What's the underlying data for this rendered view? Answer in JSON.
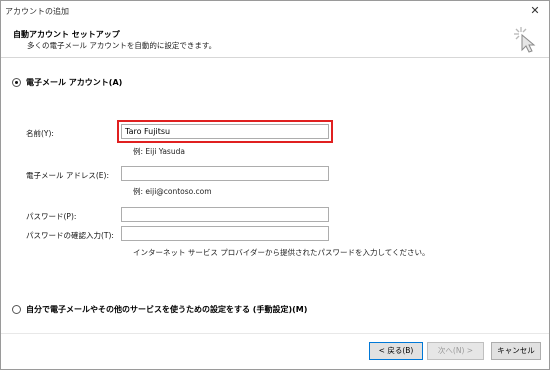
{
  "window": {
    "title": "アカウントの追加",
    "close_glyph": "✕"
  },
  "header": {
    "title": "自動アカウント セットアップ",
    "subtitle": "多くの電子メール アカウントを自動的に設定できます。",
    "icon": "wizard-cursor-icon"
  },
  "email_account": {
    "radio_label": "電子メール アカウント(A)",
    "selected": true,
    "name": {
      "label": "名前(Y):",
      "value": "Taro Fujitsu",
      "hint": "例: Eiji Yasuda"
    },
    "email": {
      "label": "電子メール アドレス(E):",
      "value": "",
      "hint": "例: eiji@contoso.com"
    },
    "password": {
      "label": "パスワード(P):",
      "value": ""
    },
    "password_confirm": {
      "label": "パスワードの確認入力(T):",
      "value": "",
      "hint": "インターネット サービス プロバイダーから提供されたパスワードを入力してください。"
    }
  },
  "manual_setup": {
    "radio_label": "自分で電子メールやその他のサービスを使うための設定をする (手動設定)(M)",
    "selected": false
  },
  "buttons": {
    "back": "< 戻る(B)",
    "next": "次へ(N) >",
    "cancel": "キャンセル"
  },
  "colors": {
    "highlight": "#e02020",
    "primary_border": "#0078d7"
  }
}
